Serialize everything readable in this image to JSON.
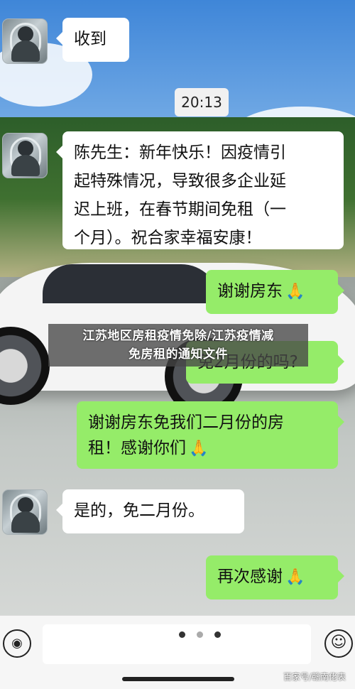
{
  "chat": {
    "timestamp": "20:13",
    "messages": [
      {
        "side": "left",
        "text": "收到"
      },
      {
        "side": "left",
        "lines": [
          "陈先生：新年快乐！因疫情引",
          "起特殊情况，导致很多企业延",
          "迟上班，在春节期间免租（一",
          "个月）。祝合家幸福安康！"
        ]
      },
      {
        "side": "right",
        "text": "谢谢房东",
        "emoji": "🙏"
      },
      {
        "side": "right",
        "text": "免2月份的吗?"
      },
      {
        "side": "right",
        "lines": [
          "谢谢房东免我们二月份的房",
          "租！感谢你们"
        ],
        "emoji": "🙏"
      },
      {
        "side": "left",
        "text": "是的，免二月份。"
      },
      {
        "side": "right",
        "text": "再次感谢",
        "emoji": "🙏"
      }
    ]
  },
  "overlay": {
    "line1": "江苏地区房租疫情免除/江苏疫情减",
    "line2": "免房租的通知文件"
  },
  "input_bar": {
    "voice_icon": "voice-icon",
    "emoji_icon": "emoji-icon",
    "voice_glyph": "◉",
    "emoji_glyph": "☺"
  },
  "watermark": "百家号/赣南佬表",
  "colors": {
    "bubble_right": "#95ec69",
    "bubble_left": "#ffffff",
    "timestamp_bg": "#f1f1f1"
  }
}
